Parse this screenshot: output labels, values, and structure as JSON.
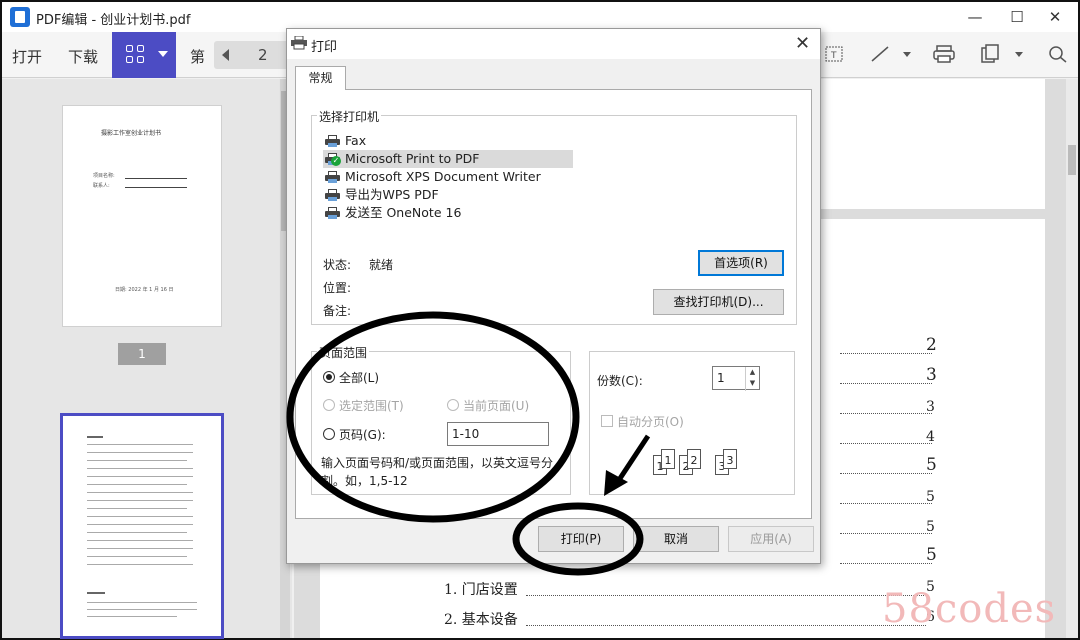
{
  "window": {
    "title": "PDF编辑 - 创业计划书.pdf",
    "minimize": "—",
    "maximize": "☐",
    "close": "✕"
  },
  "toolbar": {
    "open_label": "打开",
    "download_label": "下载",
    "page_prefix": "第",
    "page_number": "2"
  },
  "sidebar": {
    "thumb1": {
      "title": "摄影工作室创业计划书",
      "line1": "项目名称:",
      "line2": "联系人:",
      "date": "日期: 2022 年 1 月 16 日"
    },
    "page_badge": "1"
  },
  "document": {
    "toc_numbers": [
      "2",
      "3",
      "3",
      "4",
      "5",
      "5",
      "5",
      "5",
      "5",
      "6"
    ],
    "toc_items": [
      {
        "text": "1. 门店设置",
        "page": "5"
      },
      {
        "text": "2. 基本设备",
        "page": "6"
      }
    ]
  },
  "watermark": "58codes",
  "dialog": {
    "title": "打印",
    "close": "✕",
    "tab_general": "常规",
    "select_printer_label": "选择打印机",
    "printers": [
      {
        "name": "Fax",
        "default": false,
        "selected": false
      },
      {
        "name": "Microsoft Print to PDF",
        "default": true,
        "selected": true
      },
      {
        "name": "Microsoft XPS Document Writer",
        "default": false,
        "selected": false
      },
      {
        "name": "导出为WPS PDF",
        "default": false,
        "selected": false
      },
      {
        "name": "发送至 OneNote 16",
        "default": false,
        "selected": false
      }
    ],
    "status_label": "状态:",
    "status_value": "就绪",
    "location_label": "位置:",
    "comment_label": "备注:",
    "preferences_button": "首选项(R)",
    "find_printer_button": "查找打印机(D)...",
    "page_range_label": "页面范围",
    "range_all": "全部(L)",
    "range_selection": "选定范围(T)",
    "range_current": "当前页面(U)",
    "range_pages": "页码(G):",
    "pages_value": "1-10",
    "hint": "输入页面号码和/或页面范围，以英文逗号分割。如，1,5-12",
    "copies_label": "份数(C):",
    "copies_value": "1",
    "collate_label": "自动分页(O)",
    "collate_pages": [
      "1",
      "1",
      "2",
      "2",
      "3",
      "3"
    ],
    "print_button": "打印(P)",
    "cancel_button": "取消",
    "apply_button": "应用(A)"
  },
  "colors": {
    "accent": "#4c4cc4",
    "focus": "#0078d7",
    "annotation": "#000000",
    "watermark": "#f2b9b9"
  }
}
